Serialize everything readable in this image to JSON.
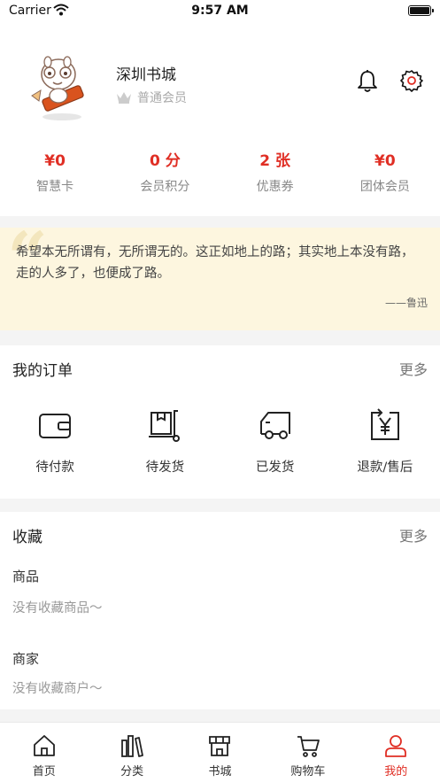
{
  "status_bar": {
    "carrier": "Carrier",
    "time": "9:57 AM"
  },
  "profile": {
    "name": "深圳书城",
    "member_level": "普通会员"
  },
  "stats": [
    {
      "value": "¥0",
      "label": "智慧卡"
    },
    {
      "value": "0 分",
      "label": "会员积分"
    },
    {
      "value": "2 张",
      "label": "优惠券"
    },
    {
      "value": "¥0",
      "label": "团体会员"
    }
  ],
  "quote": {
    "text": "希望本无所谓有，无所谓无的。这正如地上的路；其实地上本没有路，走的人多了，也便成了路。",
    "author": "——鲁迅"
  },
  "orders": {
    "title": "我的订单",
    "more": "更多",
    "items": [
      {
        "label": "待付款",
        "icon": "wallet-icon"
      },
      {
        "label": "待发货",
        "icon": "package-cart-icon"
      },
      {
        "label": "已发货",
        "icon": "truck-icon"
      },
      {
        "label": "退款/售后",
        "icon": "refund-yen-icon"
      }
    ]
  },
  "collection": {
    "title": "收藏",
    "more": "更多",
    "goods_title": "商品",
    "goods_empty": "没有收藏商品～",
    "shops_title": "商家",
    "shops_empty": "没有收藏商户～"
  },
  "tabbar": [
    {
      "label": "首页",
      "icon": "home-icon"
    },
    {
      "label": "分类",
      "icon": "books-icon"
    },
    {
      "label": "书城",
      "icon": "store-icon"
    },
    {
      "label": "购物车",
      "icon": "cart-icon"
    },
    {
      "label": "我的",
      "icon": "user-icon",
      "active": true
    }
  ],
  "colors": {
    "accent": "#e02e24",
    "quote_bg": "#fdf6df"
  }
}
